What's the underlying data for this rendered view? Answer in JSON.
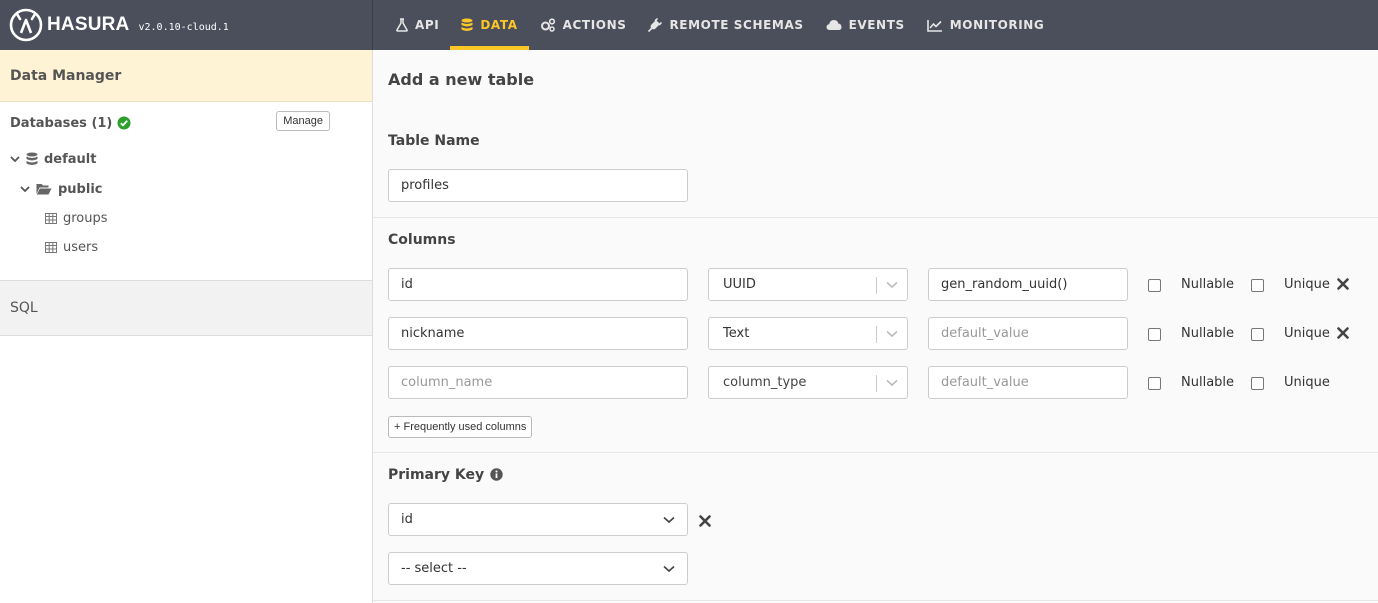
{
  "brand": {
    "name": "HASURA",
    "version": "v2.0.10-cloud.1"
  },
  "nav": [
    {
      "label": "API",
      "icon": "flask-icon"
    },
    {
      "label": "DATA",
      "icon": "database-icon",
      "active": true
    },
    {
      "label": "ACTIONS",
      "icon": "cogs-icon"
    },
    {
      "label": "REMOTE SCHEMAS",
      "icon": "plug-icon"
    },
    {
      "label": "EVENTS",
      "icon": "cloud-icon"
    },
    {
      "label": "MONITORING",
      "icon": "line-chart-icon"
    }
  ],
  "colors": {
    "accent": "#ffc627",
    "topbar": "#4b4f5b",
    "sidebar_header": "#fff3d5",
    "success": "#2c9f2c"
  },
  "sidebar": {
    "title": "Data Manager",
    "databases_label": "Databases (1)",
    "manage_label": "Manage",
    "tree": {
      "database": "default",
      "schema": "public",
      "tables": [
        "groups",
        "users"
      ]
    },
    "sql_label": "SQL"
  },
  "main": {
    "title": "Add a new table",
    "table_name_label": "Table Name",
    "table_name_value": "profiles",
    "columns_label": "Columns",
    "columns": [
      {
        "name": "id",
        "type": "UUID",
        "default": "gen_random_uuid()",
        "removable": true
      },
      {
        "name": "nickname",
        "type": "Text",
        "default": "",
        "removable": true
      },
      {
        "name": "",
        "type": "column_type",
        "default": "",
        "removable": false
      }
    ],
    "placeholders": {
      "column_name": "column_name",
      "default_value": "default_value"
    },
    "nullable_label": "Nullable",
    "unique_label": "Unique",
    "frequent_columns_label": "+ Frequently used columns",
    "primary_key_label": "Primary Key",
    "primary_keys": [
      "id"
    ],
    "pk_select_placeholder": "-- select --"
  }
}
